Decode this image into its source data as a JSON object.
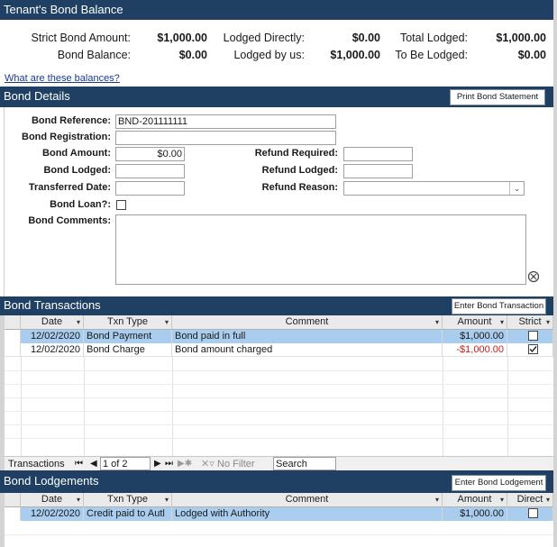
{
  "balance": {
    "title": "Tenant's Bond Balance",
    "strict_label": "Strict Bond Amount:",
    "strict_value": "$1,000.00",
    "bond_balance_label": "Bond Balance:",
    "bond_balance_value": "$0.00",
    "lodged_directly_label": "Lodged Directly:",
    "lodged_directly_value": "$0.00",
    "lodged_by_us_label": "Lodged by us:",
    "lodged_by_us_value": "$1,000.00",
    "total_lodged_label": "Total Lodged:",
    "total_lodged_value": "$1,000.00",
    "to_be_lodged_label": "To Be Lodged:",
    "to_be_lodged_value": "$0.00",
    "help_link": "What are these balances?"
  },
  "details": {
    "title": "Bond Details",
    "print_button": "Print Bond Statement",
    "reference_label": "Bond Reference:",
    "reference_value": "BND-201111111",
    "registration_label": "Bond Registration:",
    "registration_value": "",
    "amount_label": "Bond Amount:",
    "amount_value": "$0.00",
    "lodged_label": "Bond Lodged:",
    "lodged_value": "",
    "transferred_label": "Transferred Date:",
    "transferred_value": "",
    "loan_label": "Bond Loan?:",
    "loan_checked": false,
    "comments_label": "Bond Comments:",
    "comments_value": "",
    "refund_required_label": "Refund Required:",
    "refund_required_value": "",
    "refund_lodged_label": "Refund Lodged:",
    "refund_lodged_value": "",
    "refund_reason_label": "Refund Reason:",
    "refund_reason_value": ""
  },
  "transactions": {
    "title": "Bond Transactions",
    "enter_button": "Enter Bond Transaction",
    "columns": [
      "Date",
      "Txn Type",
      "Comment",
      "Amount",
      "Strict"
    ],
    "rows": [
      {
        "date": "12/02/2020",
        "type": "Bond Payment",
        "comment": "Bond paid in full",
        "amount": "$1,000.00",
        "strict": false,
        "selected": true
      },
      {
        "date": "12/02/2020",
        "type": "Bond Charge",
        "comment": "Bond amount charged",
        "amount": "-$1,000.00",
        "strict": true,
        "selected": false
      }
    ],
    "nav": {
      "label": "Transactions",
      "record": "1 of 2",
      "filter": "No Filter",
      "search": "Search"
    }
  },
  "lodgements": {
    "title": "Bond Lodgements",
    "enter_button": "Enter Bond Lodgement",
    "columns": [
      "Date",
      "Txn Type",
      "Comment",
      "Amount",
      "Direct"
    ],
    "rows": [
      {
        "date": "12/02/2020",
        "type": "Credit paid to Autl",
        "comment": "Lodged with Authority",
        "amount": "$1,000.00",
        "direct": false,
        "selected": true
      }
    ]
  },
  "colors": {
    "header_bg": "#1f4062",
    "selected_row": "#a9cdee",
    "negative_amount": "#d11a1a"
  }
}
